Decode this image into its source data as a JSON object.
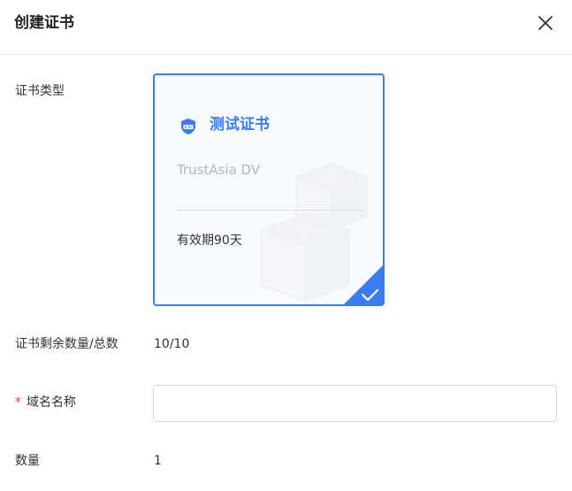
{
  "dialog": {
    "title": "创建证书",
    "close_icon": "close-icon"
  },
  "form": {
    "cert_type_label": "证书类型",
    "cert_card": {
      "name": "测试证书",
      "brand": "TrustAsia DV",
      "validity": "有效期90天",
      "selected": true,
      "icon": "ssl-shield-icon",
      "accent_color": "#3b7cf5"
    },
    "remaining_label": "证书剩余数量/总数",
    "remaining_value": "10/10",
    "required_mark": "*",
    "domain_label": "域名名称",
    "domain_value": "",
    "domain_placeholder": "",
    "quantity_label": "数量",
    "quantity_value": "1"
  }
}
